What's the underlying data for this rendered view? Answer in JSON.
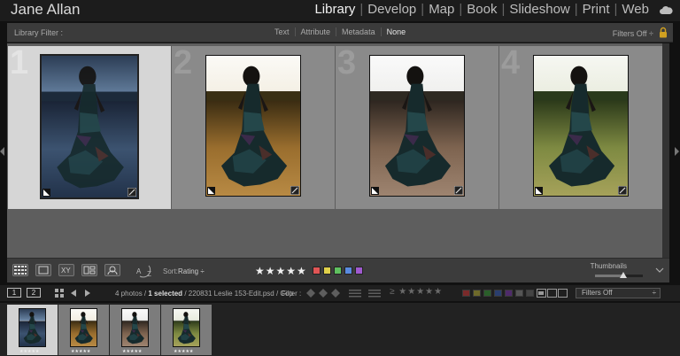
{
  "identity": {
    "name": "Jane Allan"
  },
  "modules": [
    {
      "label": "Library",
      "active": true
    },
    {
      "label": "Develop",
      "active": false
    },
    {
      "label": "Map",
      "active": false
    },
    {
      "label": "Book",
      "active": false
    },
    {
      "label": "Slideshow",
      "active": false
    },
    {
      "label": "Print",
      "active": false
    },
    {
      "label": "Web",
      "active": false
    }
  ],
  "library_filter": {
    "label": "Library Filter :",
    "tabs": [
      {
        "label": "Text",
        "active": false
      },
      {
        "label": "Attribute",
        "active": false
      },
      {
        "label": "Metadata",
        "active": false
      },
      {
        "label": "None",
        "active": true
      }
    ],
    "filters_status": "Filters Off ÷",
    "lock_icon": "lock-icon"
  },
  "grid": {
    "cells": [
      {
        "number": "1",
        "selected": true,
        "variant": "cool-blue",
        "flagged": true
      },
      {
        "number": "2",
        "selected": false,
        "variant": "warm-golden",
        "flagged": true
      },
      {
        "number": "3",
        "selected": false,
        "variant": "desaturated-brown",
        "flagged": true
      },
      {
        "number": "4",
        "selected": false,
        "variant": "natural-green",
        "flagged": true
      }
    ]
  },
  "toolbar": {
    "sort_label": "Sort:",
    "sort_value": "Rating ÷",
    "stars": "★★★★★",
    "color_labels": [
      "#e05555",
      "#e0d04a",
      "#5fc05f",
      "#5a8be0",
      "#a05ad0"
    ],
    "thumbnails_label": "Thumbnails",
    "thumbnail_size": 0.6
  },
  "filmstrip_header": {
    "monitor_1": "1",
    "monitor_2": "2",
    "photo_count": "4 photos /",
    "selected": "1 selected",
    "file": "/ 220831 Leslie 153-Edit.psd / Cop",
    "filter_label": "Filter :",
    "filter_stars": "≥ ★★★★★",
    "filter_colors": [
      "#7a2a2a",
      "#6e6a2a",
      "#2a5e2a",
      "#2a3e6e",
      "#4e2a6a",
      "#555555",
      "#444444"
    ],
    "filters_off": "Filters Off"
  },
  "filmstrip": {
    "items": [
      {
        "selected": true,
        "variant": "cool-blue",
        "stars": "★★★★★"
      },
      {
        "selected": false,
        "variant": "warm-golden",
        "stars": "★★★★★"
      },
      {
        "selected": false,
        "variant": "desaturated-brown",
        "stars": "★★★★★"
      },
      {
        "selected": false,
        "variant": "natural-green",
        "stars": "★★★★★"
      }
    ]
  }
}
